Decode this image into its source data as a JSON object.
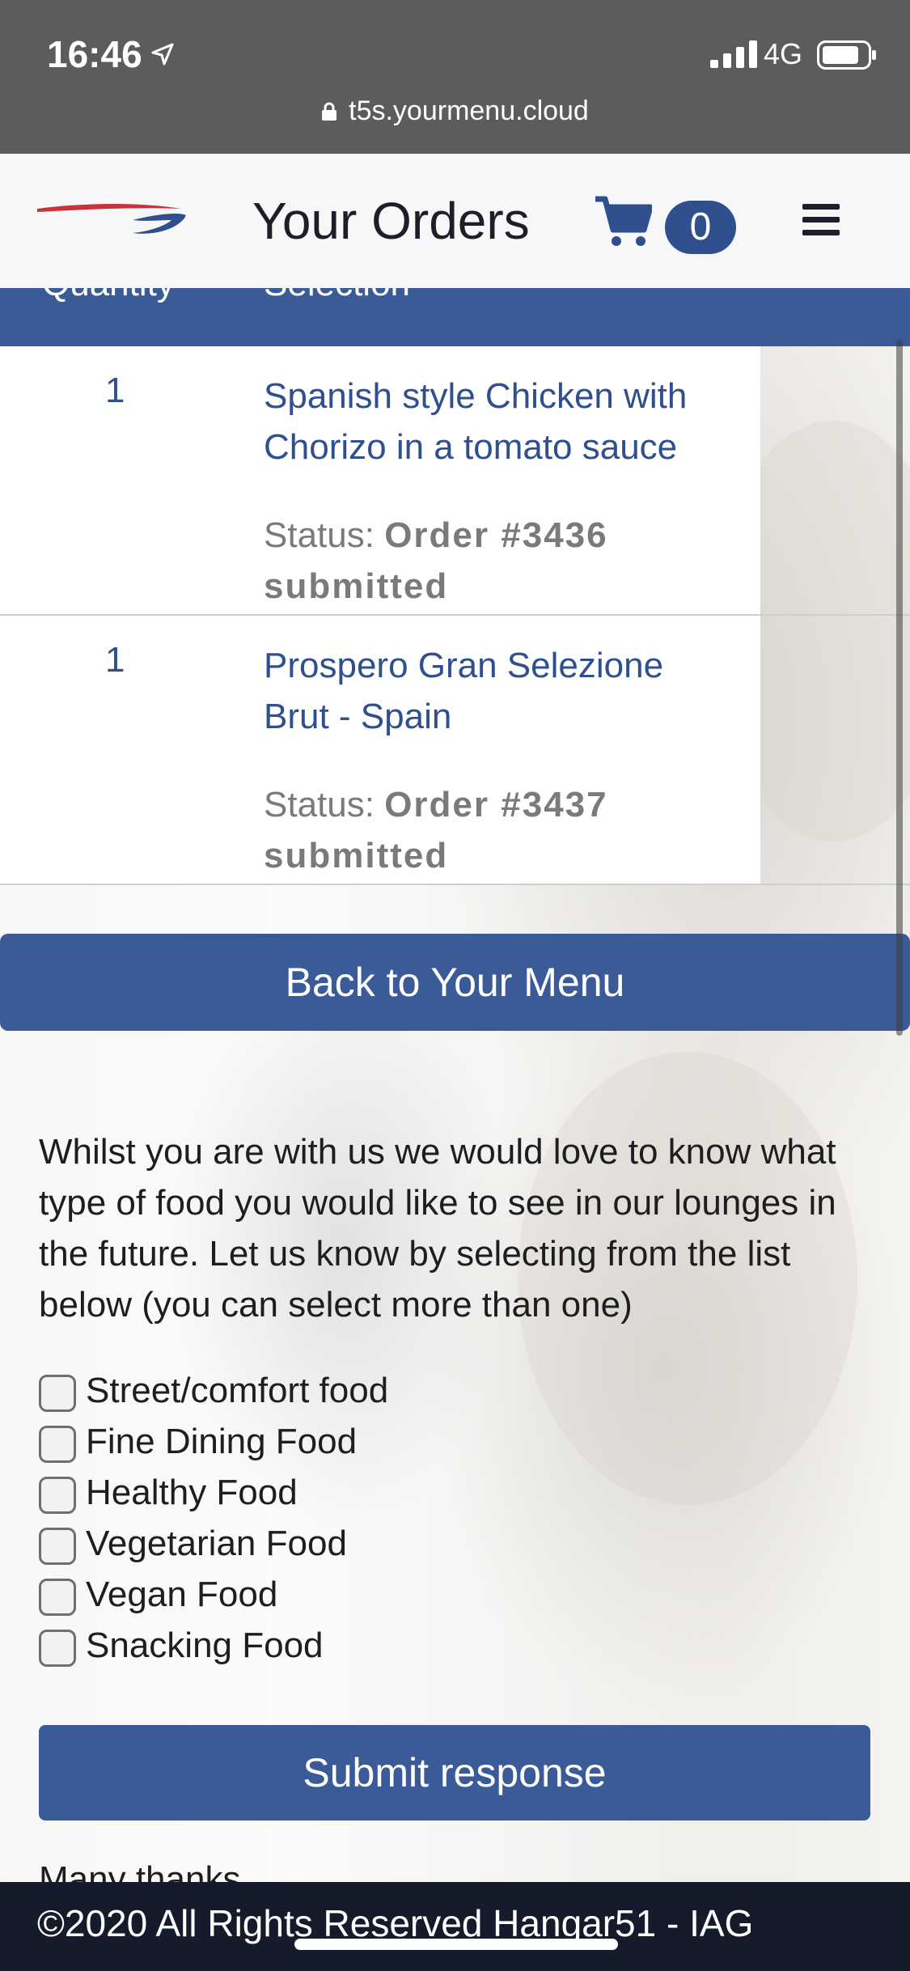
{
  "status_bar": {
    "time": "16:46",
    "network": "4G",
    "url": "t5s.yourmenu.cloud"
  },
  "header": {
    "title": "Your Orders",
    "cart_count": "0"
  },
  "table": {
    "headers": [
      "Quantity",
      "Selection"
    ],
    "rows": [
      {
        "quantity": "1",
        "selection": "Spanish style Chicken with Chorizo in a tomato sauce",
        "status_label": "Status:",
        "status_value": "Order #3436 submitted"
      },
      {
        "quantity": "1",
        "selection": "Prospero Gran Selezione Brut - Spain",
        "status_label": "Status:",
        "status_value": "Order #3437 submitted"
      }
    ]
  },
  "back_button": "Back to Your Menu",
  "survey": {
    "intro": "Whilst you are with us we would love to know what type of food you would like to see in our lounges in the future. Let us know by selecting from the list below (you can select more than one)",
    "options": [
      "Street/comfort food",
      "Fine Dining Food",
      "Healthy Food",
      "Vegetarian Food",
      "Vegan Food",
      "Snacking Food"
    ],
    "submit_label": "Submit response",
    "thanks": "Many thanks"
  },
  "footer": {
    "copyright": "©2020 All Rights Reserved Hangar51 - IAG"
  },
  "colors": {
    "brand_blue": "#3a5a98",
    "link_blue": "#2f4f8e",
    "footer": "#161b2b"
  }
}
